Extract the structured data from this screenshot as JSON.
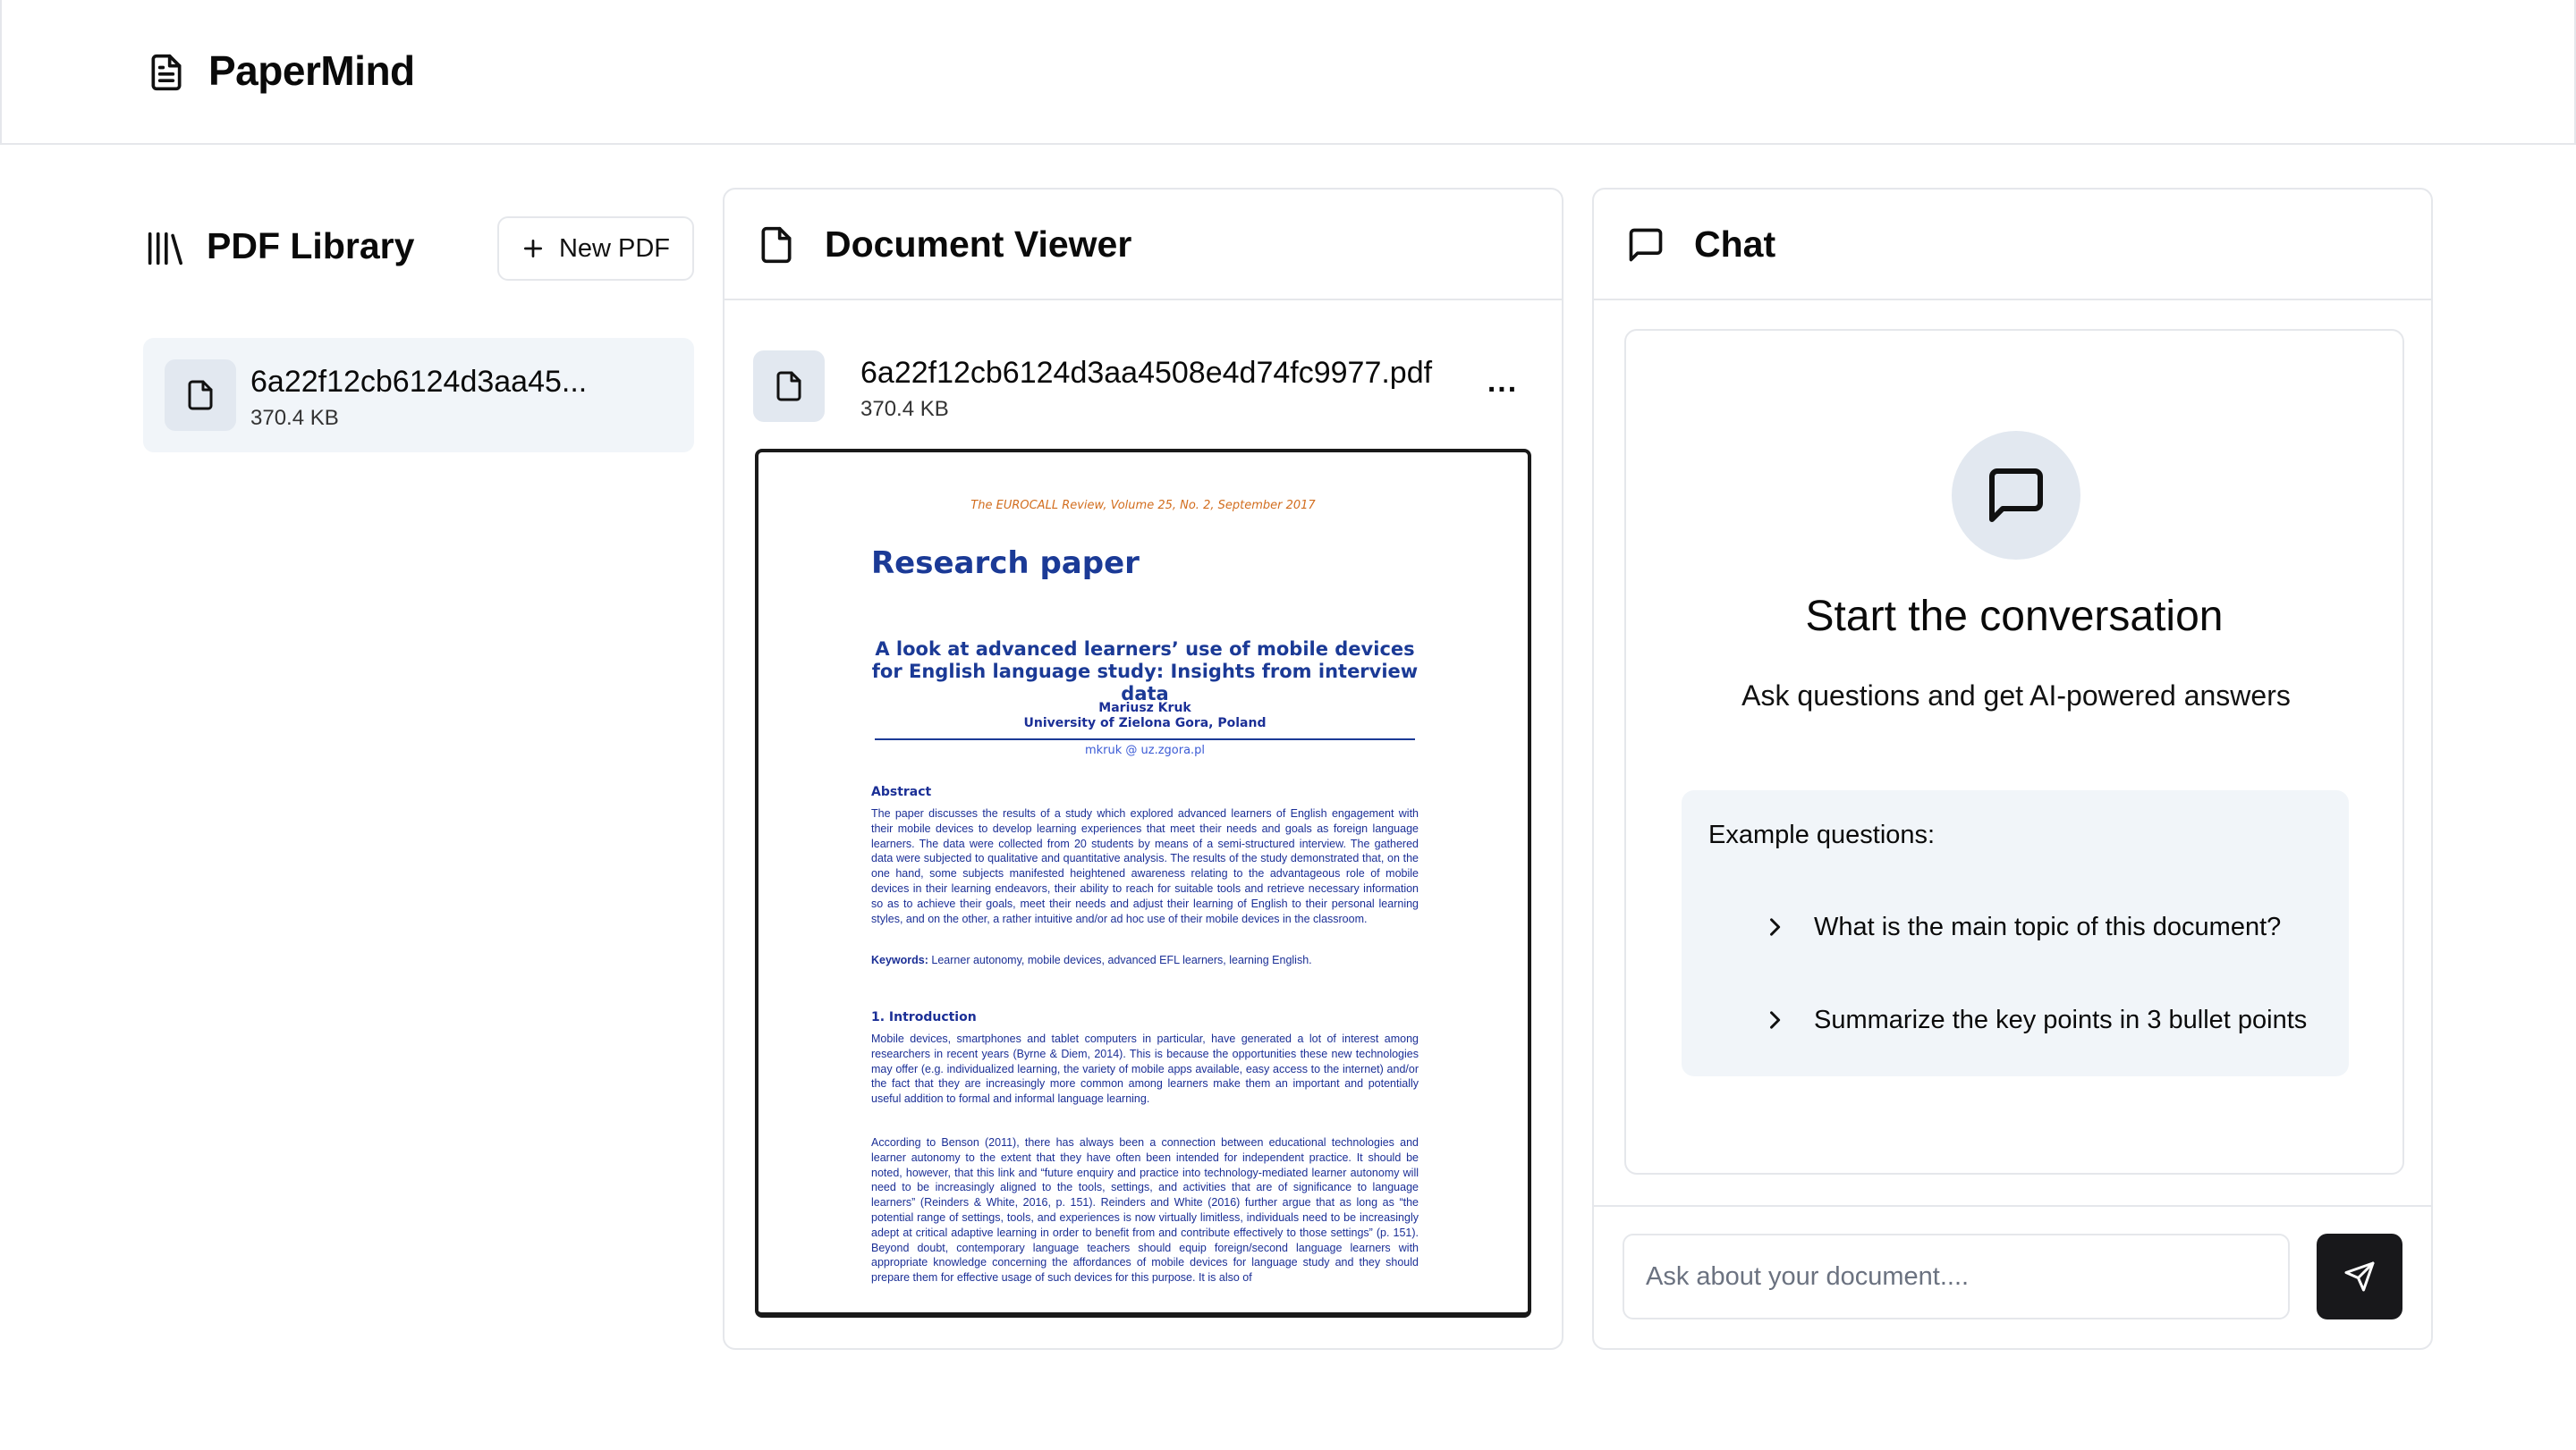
{
  "app": {
    "title": "PaperMind",
    "logo_icon": "file-text-icon"
  },
  "sidebar": {
    "title": "PDF Library",
    "icon": "library-icon",
    "new_button_label": "New PDF",
    "items": [
      {
        "name": "6a22f12cb6124d3aa45...",
        "size": "370.4 KB",
        "icon": "file-icon"
      }
    ]
  },
  "viewer": {
    "title": "Document Viewer",
    "icon": "file-icon",
    "filename": "6a22f12cb6124d3aa4508e4d74fc9977.pdf",
    "filesize": "370.4 KB",
    "more_label": "...",
    "pdf": {
      "journal": "The EUROCALL Review, Volume 25, No. 2, September 2017",
      "heading": "Research paper",
      "article_title": "A look at advanced learners’ use of mobile devices for English language study: Insights from interview data",
      "author": "Mariusz Kruk",
      "affiliation": "University of Zielona Gora, Poland",
      "email": "mkruk @ uz.zgora.pl",
      "abstract_heading": "Abstract",
      "abstract": "The paper discusses the results of a study which explored advanced learners of English engagement with their mobile devices to develop learning experiences that meet their needs and goals as foreign language learners. The data were collected from 20 students by means of a semi-structured interview. The gathered data were subjected to qualitative and quantitative analysis. The results of the study demonstrated that, on the one hand, some subjects manifested heightened awareness relating to the advantageous role of mobile devices in their learning endeavors, their ability to reach for suitable tools and retrieve necessary information so as to achieve their goals, meet their needs and adjust their learning of English to their personal learning styles, and on the other, a rather intuitive and/or ad hoc use of their mobile devices in the classroom.",
      "keywords_label": "Keywords:",
      "keywords": "Learner autonomy, mobile devices, advanced EFL learners, learning English.",
      "intro_heading": "1. Introduction",
      "intro_p1": "Mobile devices, smartphones and tablet computers in particular, have generated a lot of interest among researchers in recent years (Byrne & Diem, 2014). This is because the opportunities these new technologies may offer (e.g. individualized learning, the variety of mobile apps available, easy access to the internet) and/or the fact that they are increasingly more common among learners make them an important and potentially useful addition to formal and informal language learning.",
      "intro_p2": "According to Benson (2011), there has always been a connection between educational technologies and learner autonomy to the extent that they have often been intended for independent practice. It should be noted, however, that this link and “future enquiry and practice into technology-mediated learner autonomy will need to be increasingly aligned to the tools, settings, and activities that are of significance to language learners” (Reinders & White, 2016, p. 151). Reinders and White (2016) further argue that as long as “the potential range of settings, tools, and experiences is now virtually limitless, individuals need to be increasingly adept at critical adaptive learning in order to benefit from and contribute effectively to those settings” (p. 151). Beyond doubt, contemporary language teachers should equip foreign/second language learners with appropriate knowledge concerning the affordances of mobile devices for language study and they should prepare them for effective usage of such devices for this purpose. It is also of"
    }
  },
  "chat": {
    "title": "Chat",
    "icon": "message-square-icon",
    "empty_heading": "Start the conversation",
    "empty_subtext": "Ask questions and get AI-powered answers",
    "examples_label": "Example questions:",
    "examples": [
      "What is the main topic of this document?",
      "Summarize the key points in 3 bullet points"
    ],
    "input_placeholder": "Ask about your document....",
    "send_icon": "send-icon"
  },
  "colors": {
    "accent_dark": "#18181b",
    "muted_bg": "#f1f5f9",
    "icon_bg": "#e2e8f0",
    "border": "#e5e7eb",
    "pdf_blue": "#1b3a96",
    "pdf_orange": "#d26d1e"
  }
}
